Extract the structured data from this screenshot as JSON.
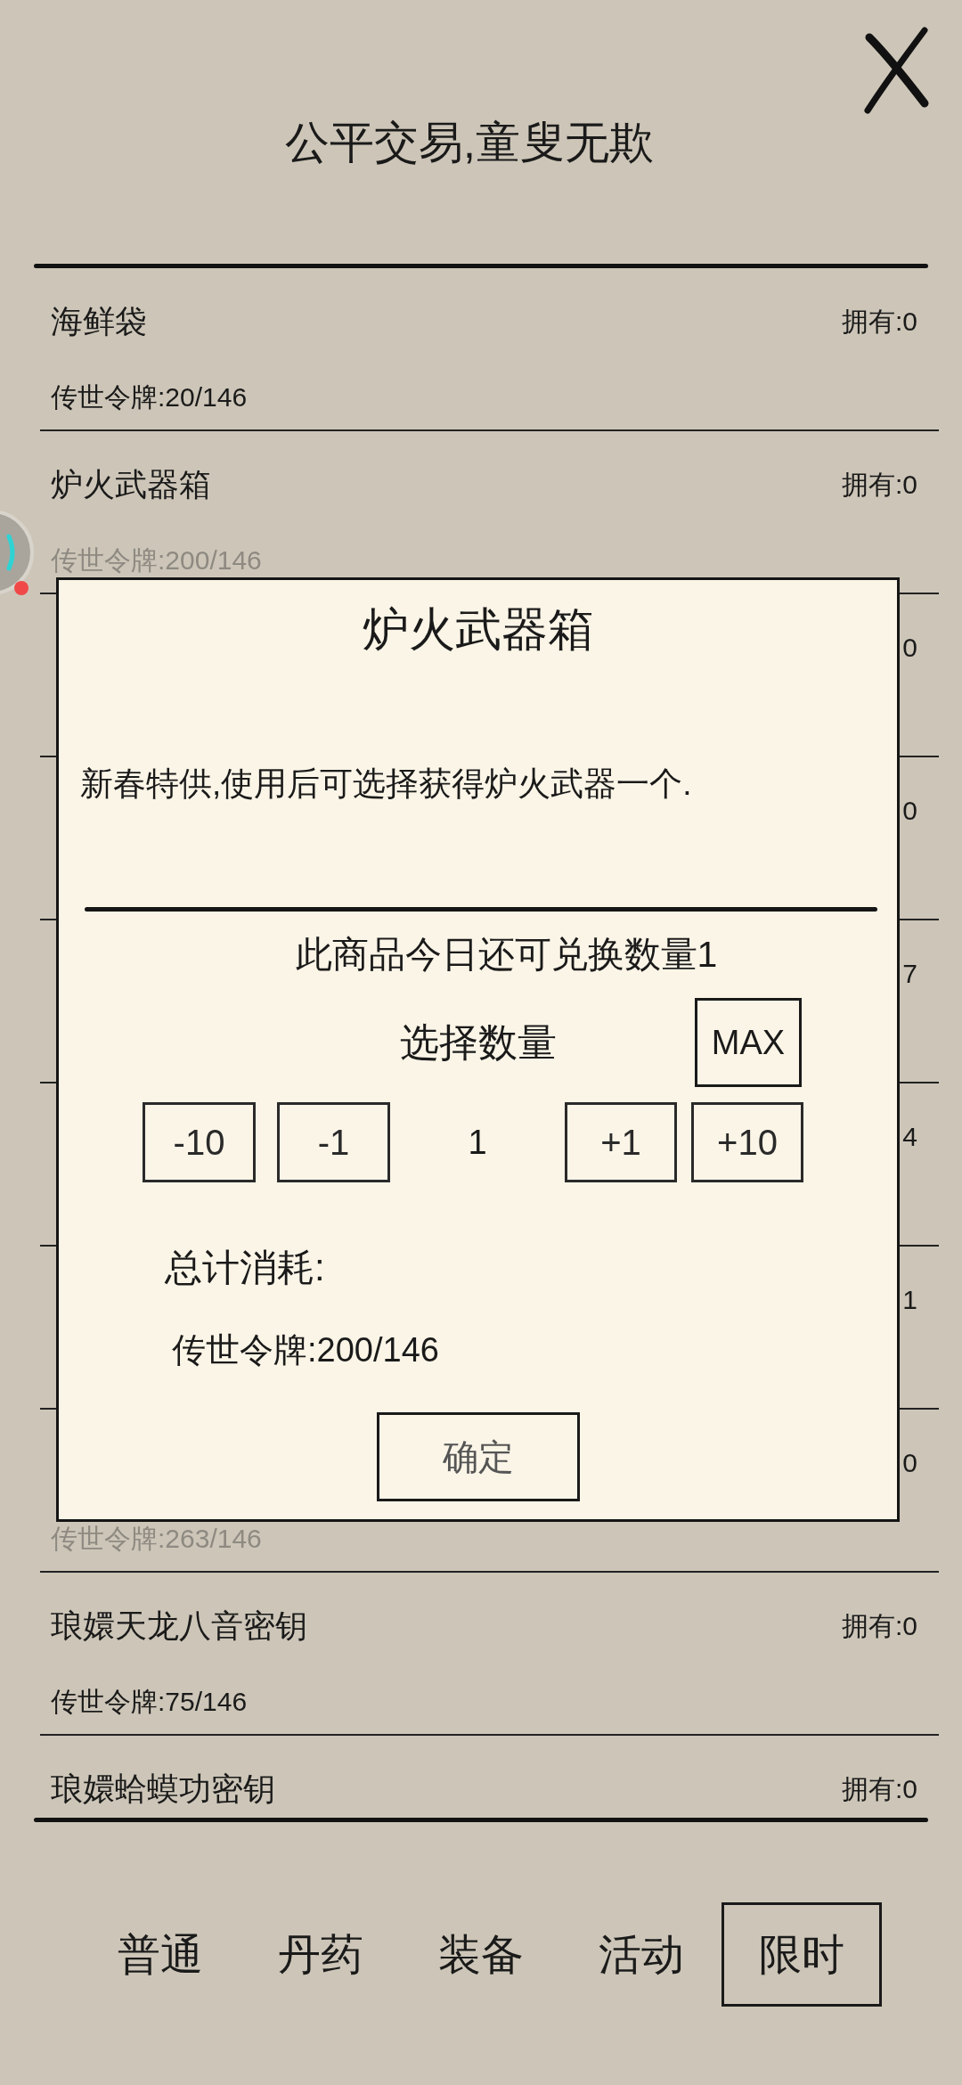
{
  "title": "公平交易,童叟无欺",
  "items": [
    {
      "name": "海鲜袋",
      "owned": "拥有:0",
      "cost": {
        "text": "传世令牌:20/146",
        "dimmed": false
      }
    },
    {
      "name": "炉火武器箱",
      "owned": "拥有:0",
      "cost": {
        "text": "传世令牌:200/146",
        "dimmed": true
      }
    },
    {
      "owned": "0"
    },
    {
      "owned": "0"
    },
    {
      "owned": "7"
    },
    {
      "owned": "4"
    },
    {
      "owned": "1"
    },
    {
      "owned": "0",
      "cost": {
        "text": "传世令牌:263/146",
        "dimmed": true
      }
    },
    {
      "name": "琅嬛天龙八音密钥",
      "owned": "拥有:0",
      "cost": {
        "text": "传世令牌:75/146",
        "dimmed": false
      }
    },
    {
      "name": "琅嬛蛤蟆功密钥",
      "owned": "拥有:0"
    }
  ],
  "dialog": {
    "title": "炉火武器箱",
    "description": "新春特供,使用后可选择获得炉火武器一个.",
    "daily_limit": "此商品今日还可兑换数量1",
    "quantity_label": "选择数量",
    "max_button": "MAX",
    "decrease_buttons": [
      "-10",
      "-1"
    ],
    "quantity": "1",
    "increase_buttons": [
      "+1",
      "+10"
    ],
    "total_label": "总计消耗:",
    "total_cost": "传世令牌:200/146",
    "confirm_button": "确定"
  },
  "tabs": [
    {
      "label": "普通",
      "selected": false
    },
    {
      "label": "丹药",
      "selected": false
    },
    {
      "label": "装备",
      "selected": false
    },
    {
      "label": "活动",
      "selected": false
    },
    {
      "label": "限时",
      "selected": true
    }
  ]
}
